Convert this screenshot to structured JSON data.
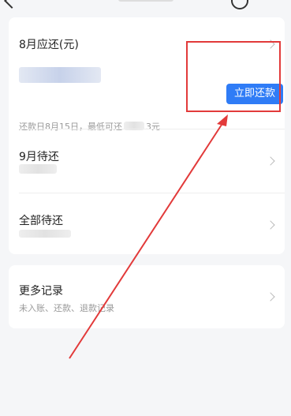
{
  "bill": {
    "current_title": "8月应还(元)",
    "pay_button": "立即还款",
    "due_prefix": "还款日8月15日，最低可还",
    "due_suffix": "3元"
  },
  "sections": [
    {
      "title": "9月待还"
    },
    {
      "title": "全部待还"
    }
  ],
  "records": {
    "title": "更多记录",
    "subtitle": "未入账、还款、退款记录"
  },
  "colors": {
    "accent": "#2f7cf6",
    "annotation": "#e23a3a"
  }
}
